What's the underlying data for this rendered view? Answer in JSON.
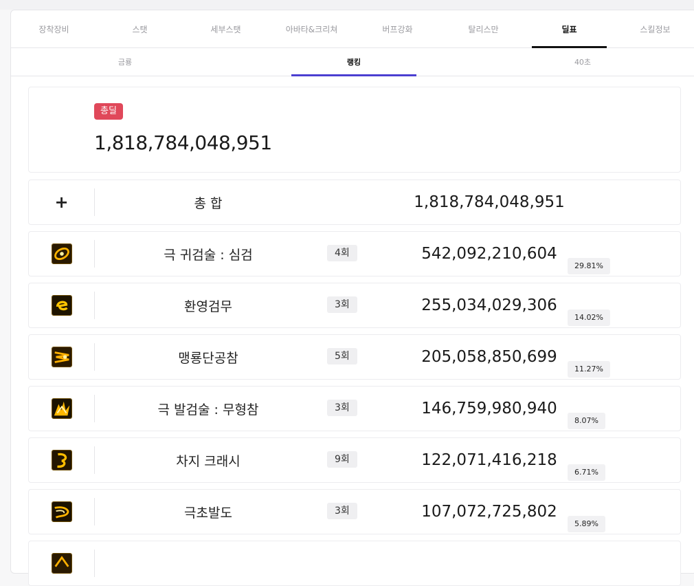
{
  "tabs_main": [
    {
      "label": "장착장비",
      "active": false
    },
    {
      "label": "스탯",
      "active": false
    },
    {
      "label": "세부스탯",
      "active": false
    },
    {
      "label": "아바타&크리쳐",
      "active": false
    },
    {
      "label": "버프강화",
      "active": false
    },
    {
      "label": "탈리스만",
      "active": false
    },
    {
      "label": "딜표",
      "active": true
    },
    {
      "label": "스킬정보",
      "active": false
    }
  ],
  "tabs_sub": [
    {
      "label": "금룡",
      "active": false
    },
    {
      "label": "랭킹",
      "active": true
    },
    {
      "label": "40초",
      "active": false
    }
  ],
  "summary": {
    "badge": "총딜",
    "total": "1,818,784,048,951"
  },
  "total_row": {
    "icon": "plus-icon",
    "symbol": "+",
    "name": "총 합",
    "damage": "1,818,784,048,951"
  },
  "skills": [
    {
      "name": "극 귀검술 : 심검",
      "count": "4회",
      "damage": "542,092,210,604",
      "percent": "29.81%",
      "icon": "skill-shimgeom-icon"
    },
    {
      "name": "환영검무",
      "count": "3회",
      "damage": "255,034,029,306",
      "percent": "14.02%",
      "icon": "skill-hwanyeong-icon"
    },
    {
      "name": "맹룡단공참",
      "count": "5회",
      "damage": "205,058,850,699",
      "percent": "11.27%",
      "icon": "skill-maengryong-icon"
    },
    {
      "name": "극 발검술 : 무형참",
      "count": "3회",
      "damage": "146,759,980,940",
      "percent": "8.07%",
      "icon": "skill-muhyeong-icon"
    },
    {
      "name": "차지 크래시",
      "count": "9회",
      "damage": "122,071,416,218",
      "percent": "6.71%",
      "icon": "skill-charge-crash-icon"
    },
    {
      "name": "극초발도",
      "count": "3회",
      "damage": "107,072,725,802",
      "percent": "5.89%",
      "icon": "skill-geukcho-icon"
    }
  ],
  "colors": {
    "badge": "#e0485a",
    "sub_tab_indicator": "#4b3fd1",
    "main_tab_indicator": "#111111"
  }
}
